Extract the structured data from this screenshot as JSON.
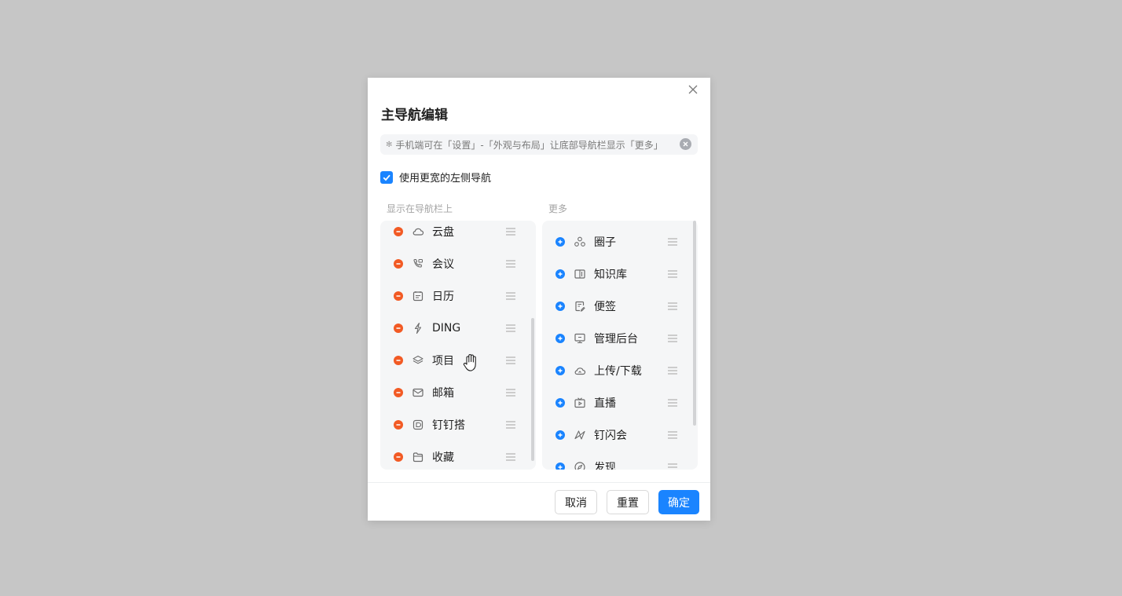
{
  "dialog": {
    "title": "主导航编辑",
    "tip": {
      "icon": "info-icon",
      "text": "手机端可在「设置」-「外观与布局」让底部导航栏显示「更多」"
    },
    "wide_nav": {
      "label": "使用更宽的左侧导航",
      "checked": true
    },
    "shown_header": "显示在导航栏上",
    "more_header": "更多",
    "shown_items": [
      {
        "label": "云盘",
        "icon": "cloud-icon"
      },
      {
        "label": "会议",
        "icon": "meeting-phone-icon"
      },
      {
        "label": "日历",
        "icon": "calendar-icon"
      },
      {
        "label": "DING",
        "icon": "lightning-icon"
      },
      {
        "label": "项目",
        "icon": "layers-icon"
      },
      {
        "label": "邮箱",
        "icon": "mail-icon"
      },
      {
        "label": "钉钉搭",
        "icon": "app-builder-icon"
      },
      {
        "label": "收藏",
        "icon": "folder-icon"
      }
    ],
    "more_items": [
      {
        "label": "圈子",
        "icon": "circle-group-icon"
      },
      {
        "label": "知识库",
        "icon": "book-icon"
      },
      {
        "label": "便签",
        "icon": "note-icon"
      },
      {
        "label": "管理后台",
        "icon": "monitor-icon"
      },
      {
        "label": "上传/下载",
        "icon": "cloud-upload-icon"
      },
      {
        "label": "直播",
        "icon": "tv-icon"
      },
      {
        "label": "钉闪会",
        "icon": "flash-meeting-icon"
      },
      {
        "label": "发现",
        "icon": "compass-icon"
      }
    ],
    "buttons": {
      "cancel": "取消",
      "reset": "重置",
      "ok": "确定"
    }
  },
  "colors": {
    "accent": "#1a84ff",
    "remove": "#f25a24",
    "backdrop": "#c6c6c6"
  }
}
